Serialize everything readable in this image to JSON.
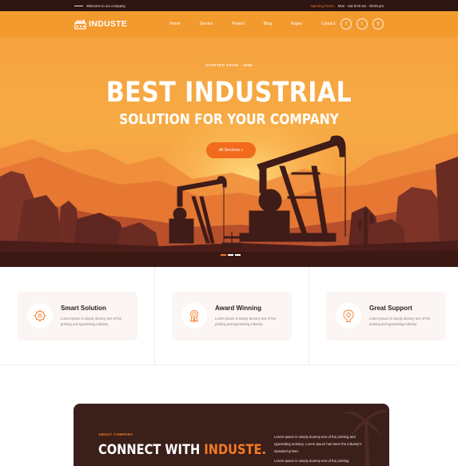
{
  "topbar": {
    "welcome": "Welcome to our company.",
    "hours_label": "Opening Hours :",
    "hours_value": "Mon - Sat 8:00 am - 05:00 pm"
  },
  "brand": {
    "name": "INDUSTE"
  },
  "nav": {
    "items": [
      {
        "label": "Home"
      },
      {
        "label": "Service"
      },
      {
        "label": "Project"
      },
      {
        "label": "Blog"
      },
      {
        "label": "Pages"
      },
      {
        "label": "Contact"
      }
    ]
  },
  "social": [
    {
      "icon": "facebook-icon",
      "glyph": "f"
    },
    {
      "icon": "twitter-icon",
      "glyph": "t"
    },
    {
      "icon": "link-icon",
      "glyph": "§"
    }
  ],
  "hero": {
    "kicker": "STARTED FROM - 1986",
    "title": "BEST INDUSTRIAL",
    "subtitle": "SOLUTION FOR YOUR COMPANY",
    "cta": "All Services »",
    "slides_total": 3,
    "slide_active": 1
  },
  "features": [
    {
      "icon": "solution-icon",
      "title": "Smart Solution",
      "text": "Lorem Ipsum is simply dummy text of the printing and typesetting industry."
    },
    {
      "icon": "award-icon",
      "title": "Award Winning",
      "text": "Lorem Ipsum is simply dummy text of the printing and typesetting industry."
    },
    {
      "icon": "support-icon",
      "title": "Great Support",
      "text": "Lorem Ipsum is simply dummy text of the printing and typesetting industry."
    }
  ],
  "about": {
    "tag": "ABOUT COMPANY",
    "heading_main": "CONNECT WITH ",
    "heading_accent": "INDUSTE.",
    "paragraph_1": "Lorem Ipsum is simply dummy text of the printing and typesetting industry. Lorem Ipsum has been the industry's standard printer.",
    "paragraph_2": "Lorem Ipsum is simply dummy text of the printing"
  },
  "colors": {
    "accent": "#f47b25",
    "nav_bg": "#f39a2e",
    "dark": "#2c1512"
  }
}
